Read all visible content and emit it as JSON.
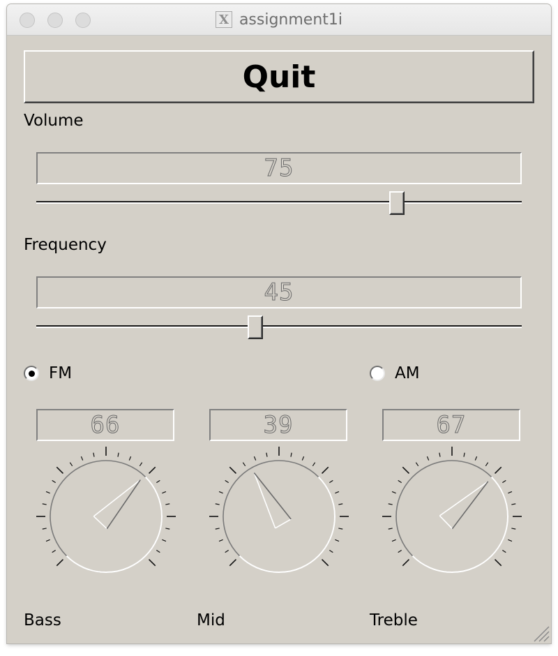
{
  "window": {
    "title": "assignment1i",
    "app_icon": "x11-icon"
  },
  "quit": {
    "label": "Quit"
  },
  "volume": {
    "label": "Volume",
    "value": "75",
    "fraction": 0.75
  },
  "frequency": {
    "label": "Frequency",
    "value": "45",
    "fraction": 0.45
  },
  "band": {
    "fm": {
      "label": "FM",
      "checked": true
    },
    "am": {
      "label": "AM",
      "checked": false
    }
  },
  "dials": {
    "bass": {
      "label": "Bass",
      "value": "66",
      "fraction": 0.66
    },
    "mid": {
      "label": "Mid",
      "value": "39",
      "fraction": 0.39
    },
    "treble": {
      "label": "Treble",
      "value": "67",
      "fraction": 0.67
    }
  },
  "colors": {
    "background": "#d4d0c8",
    "highlight": "#ffffff",
    "shadow": "#808080",
    "text": "#000000"
  }
}
